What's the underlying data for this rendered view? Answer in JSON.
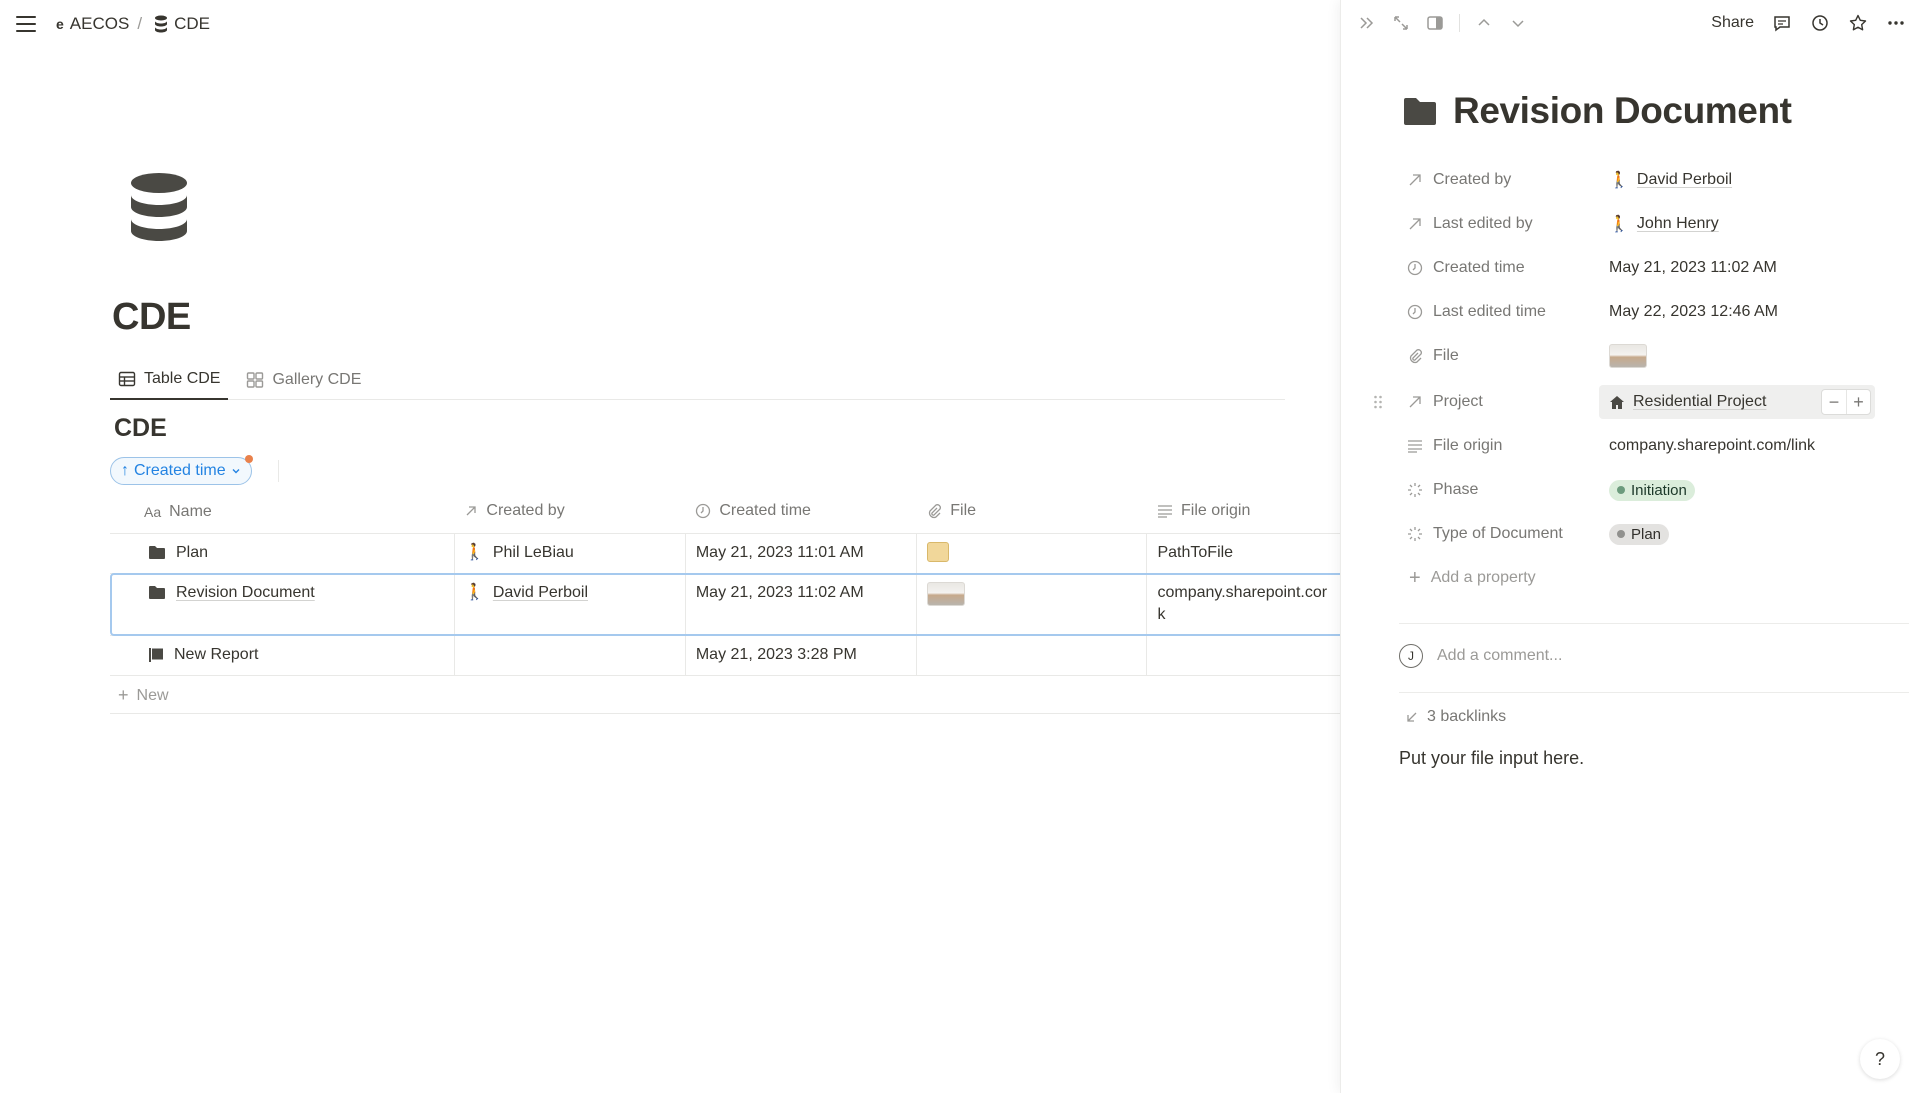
{
  "breadcrumb": {
    "workspace": "AECOS",
    "separator": "/",
    "page": "CDE"
  },
  "page": {
    "title": "CDE"
  },
  "tabs": [
    {
      "label": "Table CDE",
      "icon": "table-icon",
      "active": true
    },
    {
      "label": "Gallery CDE",
      "icon": "gallery-icon",
      "active": false
    }
  ],
  "database": {
    "title": "CDE",
    "sort_label": "Created time",
    "columns": {
      "name": "Name",
      "name_prefix": "Aa",
      "created_by": "Created by",
      "created_time": "Created time",
      "file": "File",
      "file_origin": "File origin"
    },
    "rows": [
      {
        "name": "Plan",
        "icon": "folder-icon",
        "created_by": "Phil LeBiau",
        "created_time": "May 21, 2023 11:01 AM",
        "file": "folder-thumbnail",
        "file_origin": "PathToFile"
      },
      {
        "name": "Revision Document",
        "icon": "folder-icon",
        "created_by": "David Perboil",
        "created_time": "May 21, 2023 11:02 AM",
        "file": "room-thumbnail",
        "file_origin_line1": "company.sharepoint.cor",
        "file_origin_line2": "k"
      },
      {
        "name": "New Report",
        "icon": "flag-icon",
        "created_by": "",
        "created_time": "May 21, 2023 3:28 PM",
        "file": "",
        "file_origin": ""
      }
    ],
    "new_label": "New"
  },
  "peek": {
    "share_label": "Share",
    "title": "Revision Document",
    "properties": {
      "created_by": {
        "label": "Created by",
        "value": "David Perboil"
      },
      "last_edited_by": {
        "label": "Last edited by",
        "value": "John Henry"
      },
      "created_time": {
        "label": "Created time",
        "value": "May 21, 2023 11:02 AM"
      },
      "last_edited_time": {
        "label": "Last edited time",
        "value": "May 22, 2023 12:46 AM"
      },
      "file": {
        "label": "File"
      },
      "project": {
        "label": "Project",
        "value": "Residential Project"
      },
      "file_origin": {
        "label": "File origin",
        "value": "company.sharepoint.com/link"
      },
      "phase": {
        "label": "Phase",
        "value": "Initiation",
        "color": "#dbeddb"
      },
      "type_of_document": {
        "label": "Type of Document",
        "value": "Plan",
        "color": "#e3e2e0"
      }
    },
    "add_property_label": "Add a property",
    "comment_placeholder": "Add a comment...",
    "avatar_initial": "J",
    "backlinks_label": "3 backlinks",
    "body_text": "Put your file input here."
  },
  "help_label": "?"
}
